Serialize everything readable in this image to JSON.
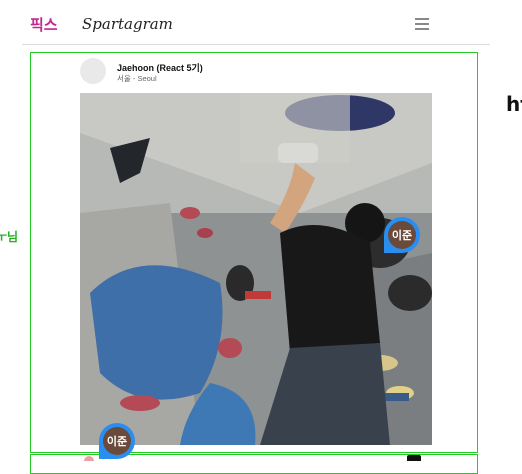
{
  "side_label": "ㅜ님",
  "right_clip": "ht",
  "header": {
    "brand_ko": "픽스",
    "brand": "Spartagram",
    "menu_icon": "hamburger-menu-icon"
  },
  "post": {
    "author": "Jaehoon (React 5기)",
    "location": "서울 - Seoul",
    "photo_alt": "bouldering wall photo",
    "tags": [
      {
        "label": "이준"
      },
      {
        "label": "이준"
      }
    ]
  },
  "colors": {
    "brand_ko": "#c0288f",
    "outline": "#22cc22",
    "tag_pin": "#2a8df0"
  }
}
